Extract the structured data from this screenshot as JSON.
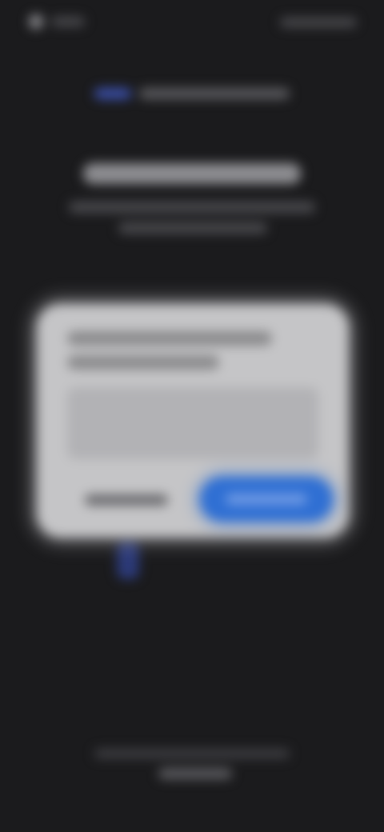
{
  "colors": {
    "background": "#1b1b1d",
    "dialog_surface": "#c5c5c7",
    "primary_button": "#2f6fd3",
    "logo_accent": "#3b4fa8"
  },
  "icons": {
    "status_icon": "circle-status-icon",
    "logo_icon": "brand-logo-icon"
  }
}
